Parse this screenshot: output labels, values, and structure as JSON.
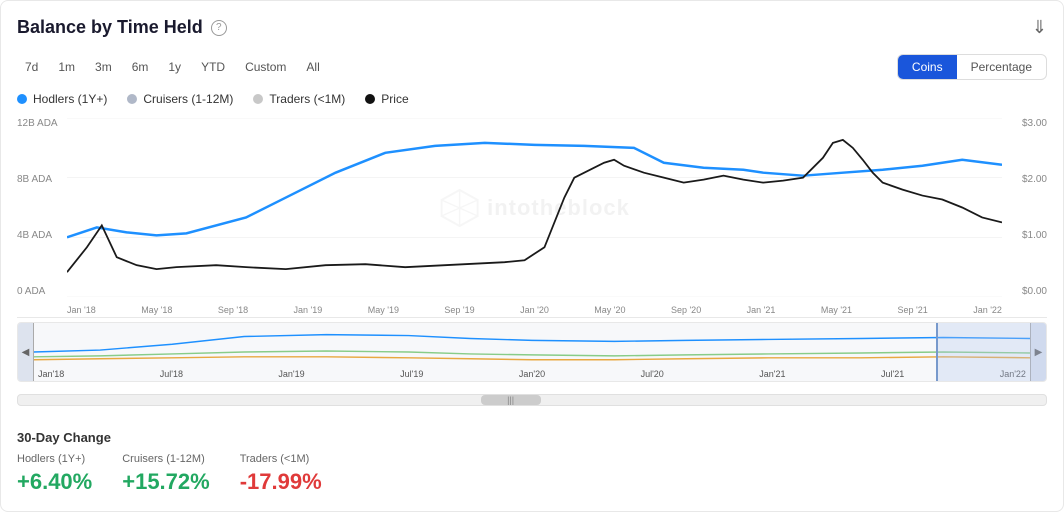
{
  "header": {
    "title": "Balance by Time Held",
    "help_label": "?",
    "download_label": "⬇"
  },
  "time_buttons": [
    {
      "label": "7d",
      "active": false
    },
    {
      "label": "1m",
      "active": false
    },
    {
      "label": "3m",
      "active": false
    },
    {
      "label": "6m",
      "active": false
    },
    {
      "label": "1y",
      "active": false
    },
    {
      "label": "YTD",
      "active": false
    },
    {
      "label": "Custom",
      "active": false
    },
    {
      "label": "All",
      "active": false
    }
  ],
  "view_toggle": {
    "coins_label": "Coins",
    "percentage_label": "Percentage"
  },
  "legend": [
    {
      "label": "Hodlers (1Y+)",
      "color": "#1E90FF"
    },
    {
      "label": "Cruisers (1-12M)",
      "color": "#b0b8c8"
    },
    {
      "label": "Traders (<1M)",
      "color": "#c8c8c8"
    },
    {
      "label": "Price",
      "color": "#111111"
    }
  ],
  "y_axis_left": [
    "12B ADA",
    "8B ADA",
    "4B ADA",
    "0 ADA"
  ],
  "y_axis_right": [
    "$3.00",
    "$2.00",
    "$1.00",
    "$0.00"
  ],
  "x_axis_labels": [
    "Jan '18",
    "May '18",
    "Sep '18",
    "Jan '19",
    "May '19",
    "Sep '19",
    "Jan '20",
    "May '20",
    "Sep '20",
    "Jan '21",
    "May '21",
    "Sep '21",
    "Jan '22"
  ],
  "minimap_x_labels": [
    "Jan'18",
    "Jul'18",
    "Jan'19",
    "Jul'19",
    "Jan'20",
    "Jul'20",
    "Jan'21",
    "Jul'21",
    "Jan'22"
  ],
  "watermark": {
    "icon": "✦",
    "text": "intotheblock"
  },
  "thirty_day_change": {
    "title": "30-Day Change",
    "columns": [
      {
        "label": "Hodlers (1Y+)",
        "value": "+6.40%",
        "positive": true
      },
      {
        "label": "Cruisers (1-12M)",
        "value": "+15.72%",
        "positive": true
      },
      {
        "label": "Traders (<1M)",
        "value": "-17.99%",
        "positive": false
      }
    ]
  }
}
